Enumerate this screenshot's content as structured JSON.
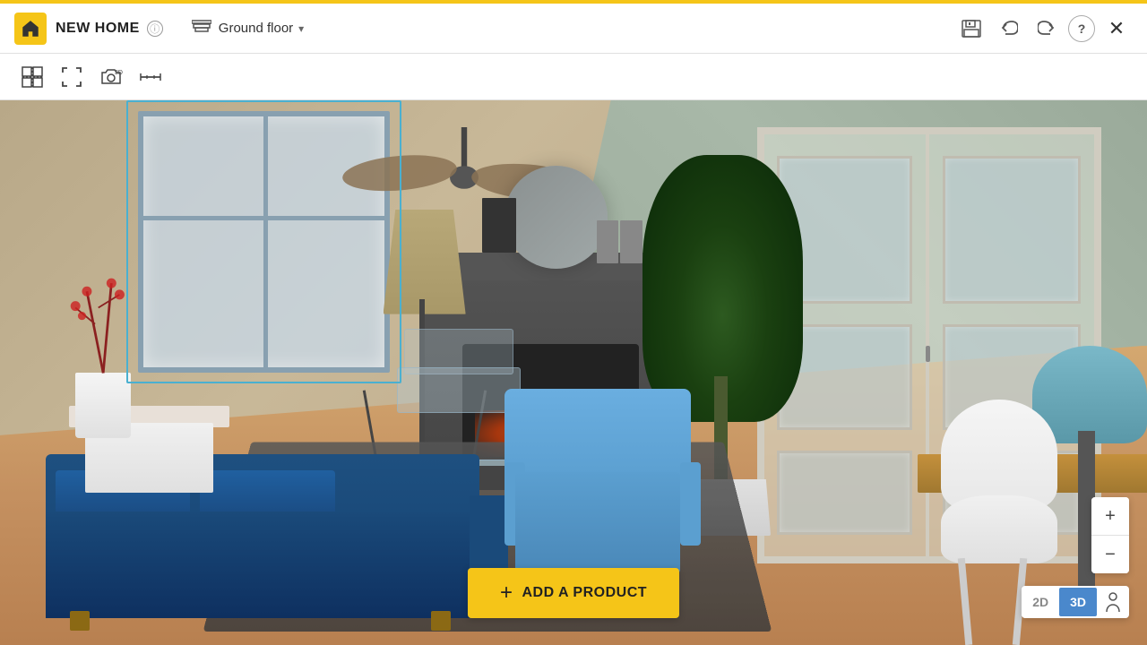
{
  "header": {
    "logo_alt": "home-planner-logo",
    "project_name": "NEW HOME",
    "info_icon": "ⓘ",
    "floor_icon": "⬡",
    "floor_name": "Ground floor",
    "chevron": "▾",
    "save_icon": "💾",
    "undo_icon": "↩",
    "redo_icon": "↪",
    "help_icon": "?",
    "close_icon": "✕"
  },
  "toolbar": {
    "grid_icon": "⊞",
    "fullscreen_icon": "⛶",
    "camera_3d_icon": "📷",
    "measure_icon": "📏"
  },
  "zoom": {
    "plus_label": "+",
    "minus_label": "−"
  },
  "view_toggle": {
    "label_2d": "2D",
    "label_3d": "3D"
  },
  "add_product": {
    "plus_symbol": "+",
    "label": "ADD A PRODUCT"
  }
}
